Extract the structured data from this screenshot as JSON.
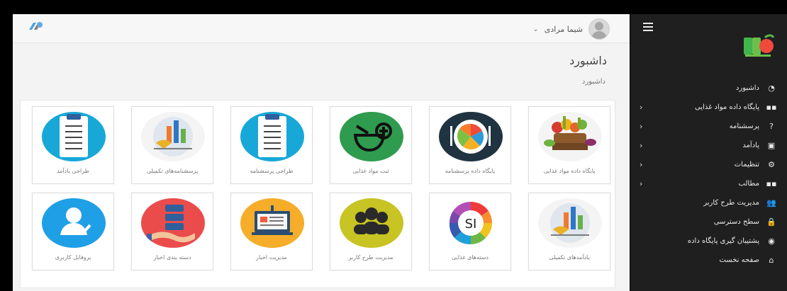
{
  "header": {
    "username": "شیما مرادی",
    "dropdown_icon": "chevron-down-icon"
  },
  "page": {
    "title": "داشبورد",
    "breadcrumb": "داشبورد"
  },
  "sidebar": {
    "items": [
      {
        "label": "داشبورد",
        "icon": "dashboard-icon",
        "has_arrow": false
      },
      {
        "label": "پایگاه داده مواد غذایی",
        "icon": "grid-icon",
        "has_arrow": true
      },
      {
        "label": "پرسشنامه",
        "icon": "question-icon",
        "has_arrow": true
      },
      {
        "label": "یادآمد",
        "icon": "calendar-icon",
        "has_arrow": true
      },
      {
        "label": "تنظیمات",
        "icon": "settings-icon",
        "has_arrow": true
      },
      {
        "label": "مطالب",
        "icon": "grid-icon",
        "has_arrow": true
      },
      {
        "label": "مدیریت طرح کاربر",
        "icon": "users-icon",
        "has_arrow": false
      },
      {
        "label": "سطح دسترسی",
        "icon": "lock-icon",
        "has_arrow": false
      },
      {
        "label": "پشتیبان گیری پایگاه داده",
        "icon": "database-icon",
        "has_arrow": false
      },
      {
        "label": "صفحه نخست",
        "icon": "home-icon",
        "has_arrow": false
      }
    ]
  },
  "tiles": [
    {
      "label": "پایگاه داده مواد غذایی",
      "icon": "fruits-basket-icon",
      "bg": "#f4f4f4"
    },
    {
      "label": "پایگاه داده پرسشنامه",
      "icon": "plate-icon",
      "bg": "#1f3340"
    },
    {
      "label": "ثبت مواد غذایی",
      "icon": "bowl-plus-icon",
      "bg": "#2f9b4f"
    },
    {
      "label": "طراحی پرسشنامه",
      "icon": "clipboard-icon",
      "bg": "#18a8d8"
    },
    {
      "label": "پرسشنامه‌های تکمیلی",
      "icon": "charts-icon",
      "bg": "#f4f4f4"
    },
    {
      "label": "طراحی یادآمد",
      "icon": "clipboard-icon",
      "bg": "#18a8d8"
    },
    {
      "label": "یادآمدهای تکمیلی",
      "icon": "charts-icon",
      "bg": "#f4f4f4"
    },
    {
      "label": "دسته‌های غذایی",
      "icon": "si-wheel-icon",
      "bg": "#ffffff"
    },
    {
      "label": "مدیریت طرح کاربر",
      "icon": "group-icon",
      "bg": "#c7c423"
    },
    {
      "label": "مدیریت اخبار",
      "icon": "news-board-icon",
      "bg": "#f6ad29"
    },
    {
      "label": "دسته بندی اخبار",
      "icon": "server-hand-icon",
      "bg": "#ea4c4c"
    },
    {
      "label": "پروفایل کاربری",
      "icon": "user-check-icon",
      "bg": "#1f9fe6"
    }
  ]
}
